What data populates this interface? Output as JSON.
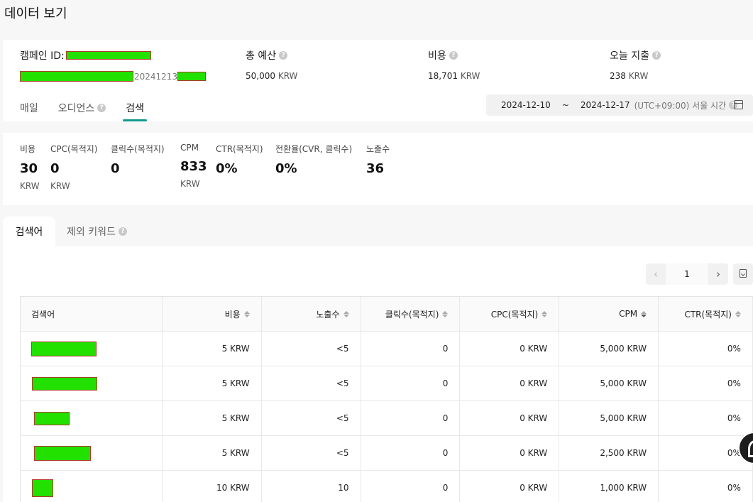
{
  "page": {
    "title": "데이터 보기"
  },
  "campaign": {
    "id_label": "캠페인 ID:",
    "id_suffix": "20241213",
    "budget": {
      "label": "총 예산",
      "value": "50,000",
      "unit": "KRW"
    },
    "cost": {
      "label": "비용",
      "value": "18,701",
      "unit": "KRW"
    },
    "today": {
      "label": "오늘 지출",
      "value": "238",
      "unit": "KRW"
    }
  },
  "view_tabs": [
    {
      "label": "매일"
    },
    {
      "label": "오디언스"
    },
    {
      "label": "검색"
    }
  ],
  "date_range": {
    "start": "2024-12-10",
    "separator": "~",
    "end": "2024-12-17",
    "timezone": "(UTC+09:00) 서울 시간"
  },
  "metrics": [
    {
      "label": "비용",
      "value": "30",
      "unit": "KRW"
    },
    {
      "label": "CPC(목적지)",
      "value": "0",
      "unit": "KRW"
    },
    {
      "label": "클릭수(목적지)",
      "value": "0",
      "unit": ""
    },
    {
      "label": "CPM",
      "value": "833",
      "unit": "KRW"
    },
    {
      "label": "CTR(목적지)",
      "value": "0%",
      "unit": ""
    },
    {
      "label": "전환율(CVR, 클릭수)",
      "value": "0%",
      "unit": ""
    },
    {
      "label": "노출수",
      "value": "36",
      "unit": ""
    }
  ],
  "sub_tabs": [
    {
      "label": "검색어"
    },
    {
      "label": "제외 키워드"
    }
  ],
  "pager": {
    "page": "1",
    "prev_glyph": "‹",
    "next_glyph": "›"
  },
  "table": {
    "columns": [
      "검색어",
      "비용",
      "노출수",
      "클릭수(목적지)",
      "CPC(목적지)",
      "CPM",
      "CTR(목적지)"
    ],
    "rows": [
      [
        "",
        "5 KRW",
        "<5",
        "0",
        "0 KRW",
        "5,000 KRW",
        "0%"
      ],
      [
        "",
        "5 KRW",
        "<5",
        "0",
        "0 KRW",
        "5,000 KRW",
        "0%"
      ],
      [
        "",
        "5 KRW",
        "<5",
        "0",
        "0 KRW",
        "5,000 KRW",
        "0%"
      ],
      [
        "",
        "5 KRW",
        "<5",
        "0",
        "0 KRW",
        "2,500 KRW",
        "0%"
      ],
      [
        "",
        "10 KRW",
        "10",
        "0",
        "0 KRW",
        "1,000 KRW",
        "0%"
      ]
    ]
  },
  "colors": {
    "accent": "#139a8f",
    "redaction": "#22e000"
  }
}
